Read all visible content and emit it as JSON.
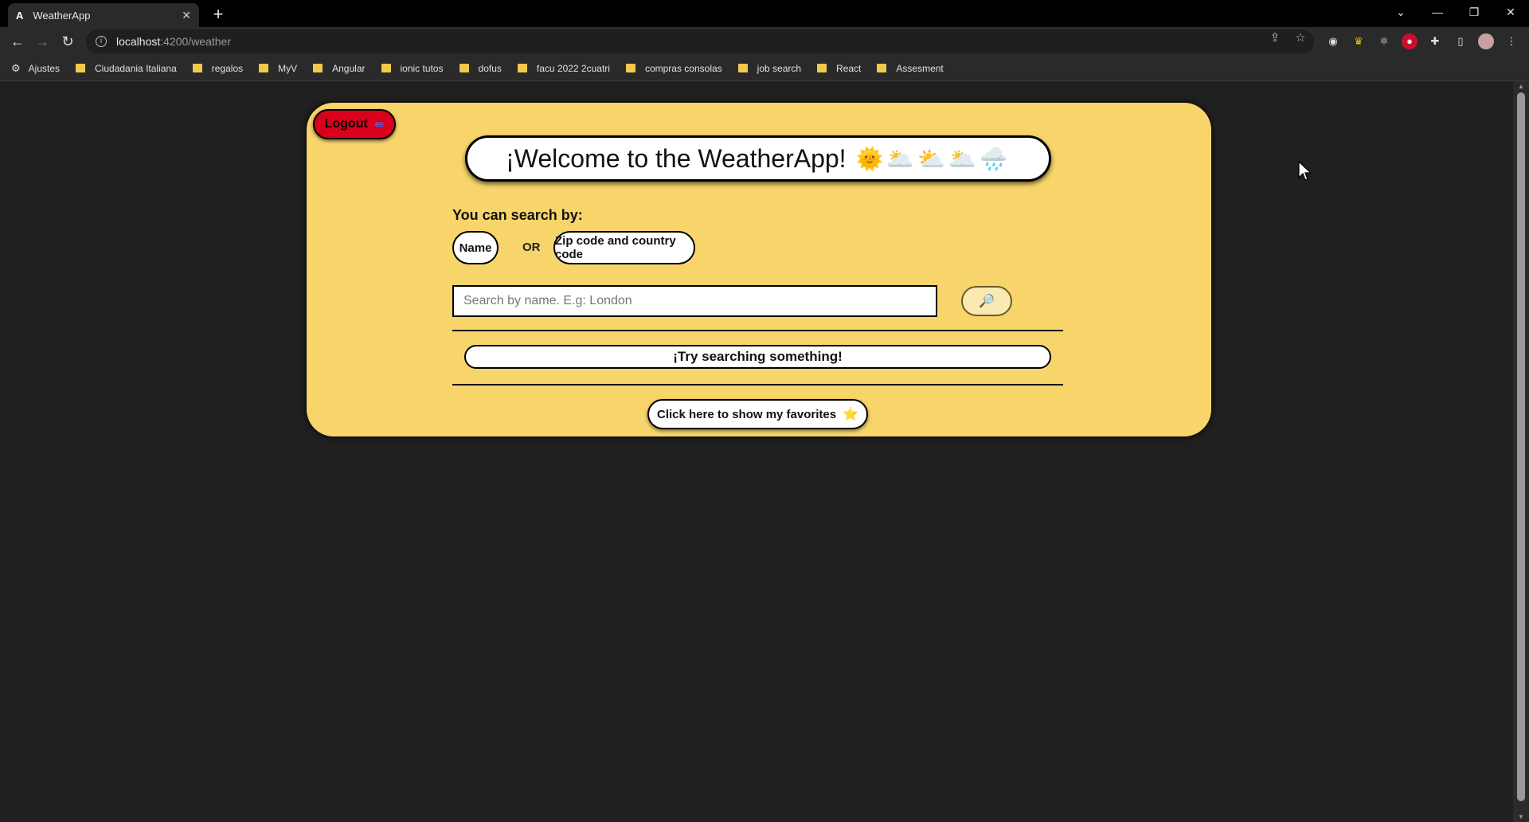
{
  "browser": {
    "tab_title": "WeatherApp",
    "tab_favicon": "A",
    "url_host": "localhost",
    "url_path": ":4200/weather",
    "bookmarks": [
      {
        "label": "Ajustes",
        "icon": "gear-icon"
      },
      {
        "label": "Ciudadania Italiana",
        "icon": "folder-icon"
      },
      {
        "label": "regalos",
        "icon": "folder-icon"
      },
      {
        "label": "MyV",
        "icon": "folder-icon"
      },
      {
        "label": "Angular",
        "icon": "folder-icon"
      },
      {
        "label": "ionic tutos",
        "icon": "folder-icon"
      },
      {
        "label": "dofus",
        "icon": "folder-icon"
      },
      {
        "label": "facu 2022 2cuatri",
        "icon": "folder-icon"
      },
      {
        "label": "compras consolas",
        "icon": "folder-icon"
      },
      {
        "label": "job search",
        "icon": "folder-icon"
      },
      {
        "label": "React",
        "icon": "folder-icon"
      },
      {
        "label": "Assesment",
        "icon": "folder-icon"
      }
    ]
  },
  "app": {
    "logout_label": "Logout",
    "welcome_title": "¡Welcome to the WeatherApp!",
    "welcome_emojis": "🌞🌥️⛅🌥️🌧️",
    "search_by_label": "You can search by:",
    "option_name": "Name",
    "or_label": "OR",
    "option_zip": "Zip code and country code",
    "search_placeholder": "Search by name. E.g: London",
    "search_button_icon": "🔎",
    "result_message": "¡Try searching something!",
    "favorites_label": "Click here to show my favorites",
    "favorites_icon": "⭐"
  },
  "colors": {
    "card_background": "#f7d56b",
    "logout_background": "#d9001b",
    "page_background": "#202020"
  }
}
